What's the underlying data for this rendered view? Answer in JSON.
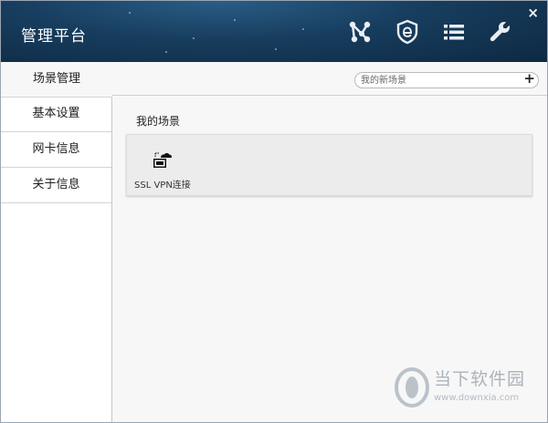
{
  "window": {
    "title": "管理平台",
    "close_symbol": "×"
  },
  "header_icons": [
    {
      "name": "network-topology-icon"
    },
    {
      "name": "browser-shield-icon"
    },
    {
      "name": "list-icon"
    },
    {
      "name": "wrench-icon"
    }
  ],
  "sidebar": {
    "items": [
      {
        "label": "场景管理",
        "active": true
      },
      {
        "label": "基本设置",
        "active": false
      },
      {
        "label": "网卡信息",
        "active": false
      },
      {
        "label": "关于信息",
        "active": false
      }
    ]
  },
  "content": {
    "search_placeholder": "我的新场景",
    "add_symbol": "+",
    "section_title": "我的场景",
    "scenes": [
      {
        "label": "SSL VPN连接",
        "icon": "cloud-computer-icon"
      }
    ]
  },
  "watermark": {
    "text": "当下软件园",
    "url": "www.downxia.com"
  }
}
